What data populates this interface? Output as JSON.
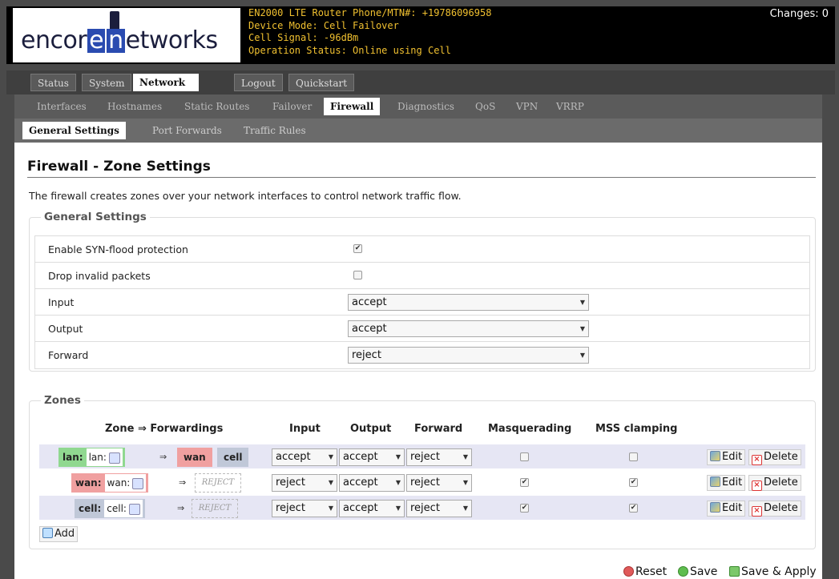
{
  "header": {
    "logo_text_1": "encor",
    "logo_box_1": "e",
    "logo_box_2": "n",
    "logo_text_2": "etworks",
    "info_lines": [
      "EN2000 LTE Router Phone/MTN#: +19786096958",
      "Device Mode: Cell Failover",
      "Cell Signal: -96dBm",
      "Operation Status: Online using Cell"
    ],
    "changes": "Changes: 0"
  },
  "nav": {
    "main_tabs": [
      "Status",
      "System",
      "Network",
      "Logout",
      "Quickstart"
    ],
    "main_active": "Network",
    "sub_tabs": [
      "Interfaces",
      "Hostnames",
      "Static Routes",
      "Failover",
      "Firewall",
      "Diagnostics",
      "QoS",
      "VPN",
      "VRRP"
    ],
    "sub_active": "Firewall",
    "third_tabs": [
      "General Settings",
      "Port Forwards",
      "Traffic Rules"
    ],
    "third_active": "General Settings"
  },
  "page": {
    "title": "Firewall - Zone Settings",
    "description": "The firewall creates zones over your network interfaces to control network traffic flow."
  },
  "general_settings": {
    "legend": "General Settings",
    "syn_flood_label": "Enable SYN-flood protection",
    "syn_flood_checked": true,
    "drop_invalid_label": "Drop invalid packets",
    "drop_invalid_checked": false,
    "input_label": "Input",
    "input_value": "accept",
    "output_label": "Output",
    "output_value": "accept",
    "forward_label": "Forward",
    "forward_value": "reject"
  },
  "zones": {
    "legend": "Zones",
    "headers": {
      "zone": "Zone ⇒ Forwardings",
      "input": "Input",
      "output": "Output",
      "forward": "Forward",
      "masquerading": "Masquerading",
      "mss": "MSS clamping"
    },
    "rows": [
      {
        "name": "lan:",
        "sub": "lan:",
        "color": "#90d890",
        "forwards": [
          "wan",
          "cell"
        ],
        "input": "accept",
        "output": "accept",
        "forward": "reject",
        "masq": false,
        "mss": false
      },
      {
        "name": "wan:",
        "sub": "wan:",
        "color": "#f0a0a0",
        "forwards": [
          "REJECT"
        ],
        "input": "reject",
        "output": "accept",
        "forward": "reject",
        "masq": true,
        "mss": true
      },
      {
        "name": "cell:",
        "sub": "cell:",
        "color": "#c0c8d8",
        "forwards": [
          "REJECT"
        ],
        "input": "reject",
        "output": "accept",
        "forward": "reject",
        "masq": true,
        "mss": true
      }
    ],
    "arrow": "⇒",
    "edit_label": "Edit",
    "delete_label": "Delete",
    "add_label": "Add"
  },
  "footer": {
    "reset_label": "Reset",
    "save_label": "Save",
    "save_apply_label": "Save & Apply"
  },
  "colors": {
    "header_text": "#f0c030",
    "lan": "#90d890",
    "wan": "#f0a0a0",
    "cell": "#c0c8d8"
  }
}
